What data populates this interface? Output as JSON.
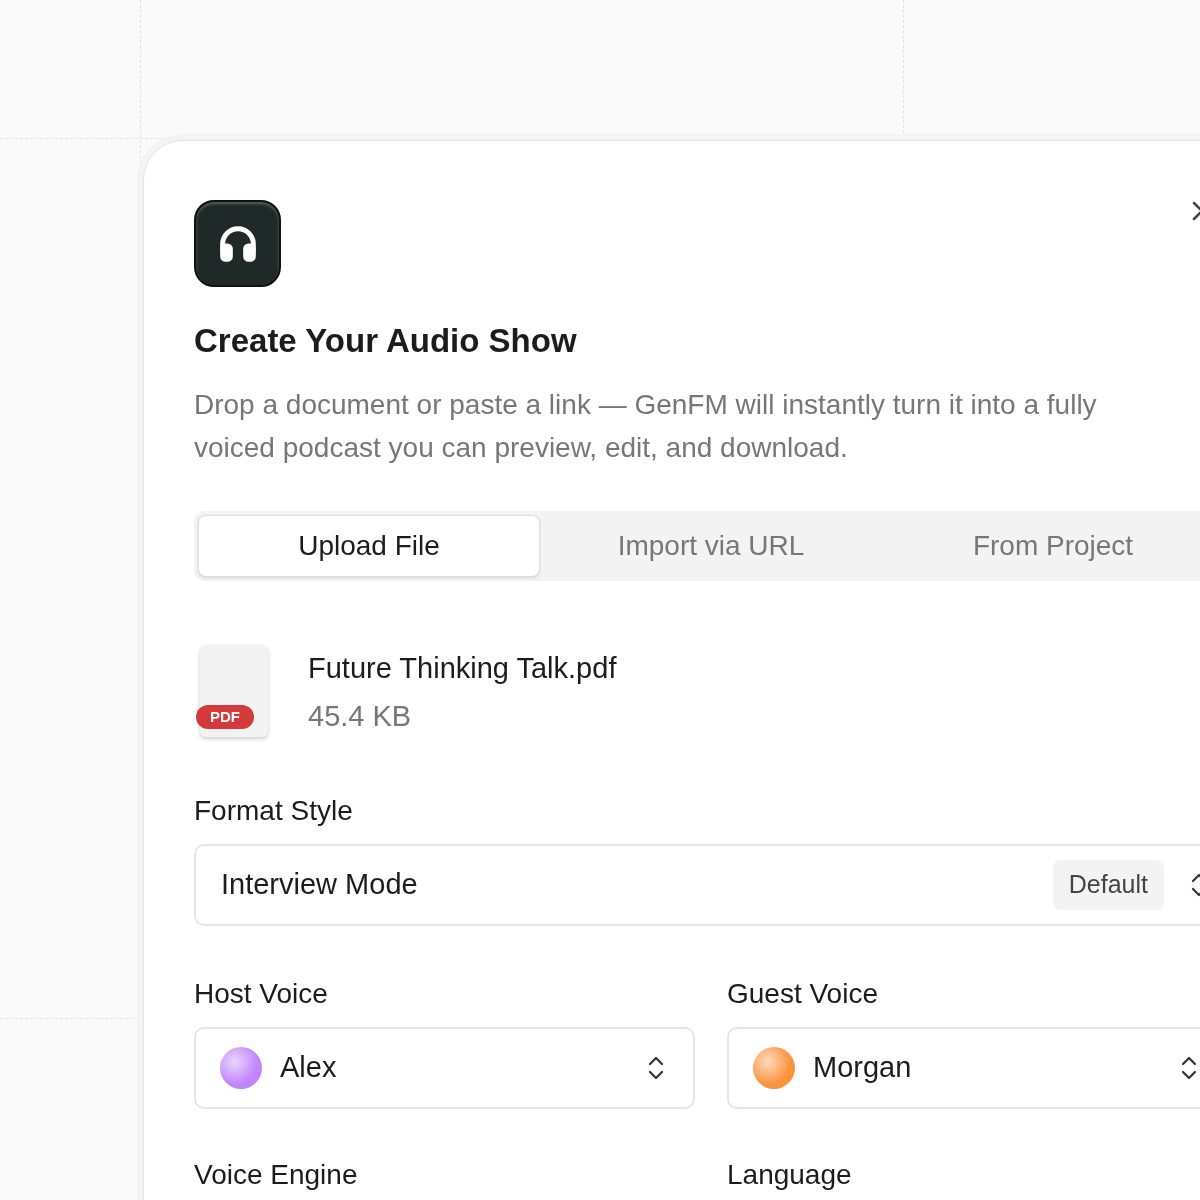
{
  "dialog": {
    "title": "Create Your Audio Show",
    "description": "Drop a document or paste a link — GenFM will instantly turn it into a fully voiced podcast you can preview, edit, and download."
  },
  "tabs": [
    {
      "label": "Upload File",
      "selected": true
    },
    {
      "label": "Import via URL",
      "selected": false
    },
    {
      "label": "From Project",
      "selected": false
    }
  ],
  "file": {
    "badge": "PDF",
    "name": "Future Thinking Talk.pdf",
    "size": "45.4 KB"
  },
  "format_style": {
    "label": "Format Style",
    "value": "Interview Mode",
    "badge": "Default"
  },
  "voices": [
    {
      "label": "Host Voice",
      "value": "Alex",
      "color": "#c084fc"
    },
    {
      "label": "Guest Voice",
      "value": "Morgan",
      "color": "#fb923c"
    }
  ],
  "more_fields": [
    {
      "label": "Voice Engine"
    },
    {
      "label": "Language"
    }
  ]
}
